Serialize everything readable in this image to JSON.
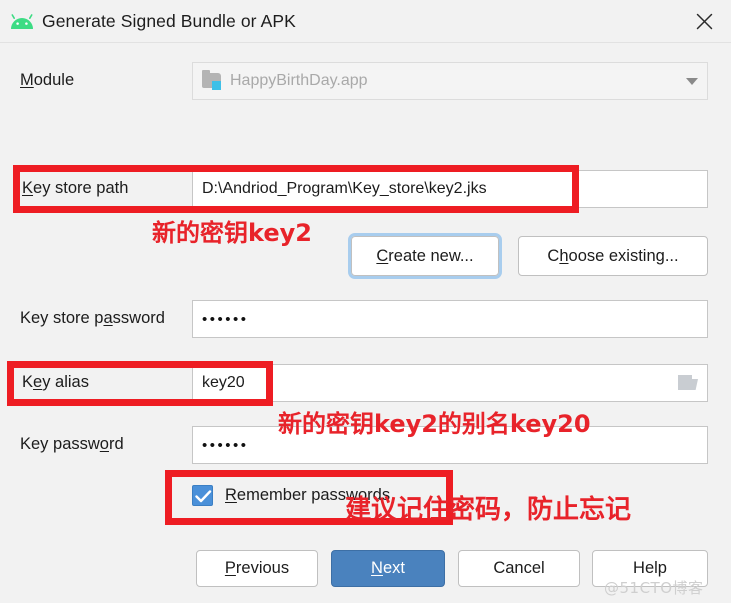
{
  "window": {
    "title": "Generate Signed Bundle or APK",
    "app_icon": "android-icon",
    "close_icon": "close-icon"
  },
  "form": {
    "module": {
      "label": "Module",
      "value": "HappyBirthDay.app",
      "icon": "folder-icon",
      "dropdown_icon": "chevron-down-icon",
      "disabled": true
    },
    "key_store_path": {
      "label_prefix": "K",
      "label_rest": "ey store path",
      "value": "D:\\Andriod_Program\\Key_store\\key2.jks"
    },
    "key_store_password": {
      "label_prefix": "Key store p",
      "label_mnemonic": "a",
      "label_rest": "ssword",
      "value": "••••••"
    },
    "key_alias": {
      "label_prefix": "K",
      "label_mnemonic": "e",
      "label_rest": "y alias",
      "value": "key20",
      "icon": "folder-icon"
    },
    "key_password": {
      "label_prefix": "Key passw",
      "label_mnemonic": "o",
      "label_rest": "rd",
      "value": "••••••"
    },
    "remember_passwords": {
      "label_prefix": "R",
      "label_rest": "emember passwords",
      "checked": true
    }
  },
  "buttons": {
    "create_new": {
      "prefix": "C",
      "mnemonic": "",
      "rest": "reate new..."
    },
    "choose_existing": {
      "prefix": "C",
      "mnemonic": "h",
      "rest": "oose existing..."
    },
    "previous": {
      "prefix": "",
      "mnemonic": "P",
      "rest": "revious"
    },
    "next": {
      "prefix": "",
      "mnemonic": "N",
      "rest": "ext"
    },
    "cancel": {
      "label": "Cancel"
    },
    "help": {
      "label": "Help"
    }
  },
  "annotations": [
    {
      "id": "key2",
      "text": "新的密钥key2"
    },
    {
      "id": "alias",
      "text": "新的密钥key2的别名key20"
    },
    {
      "id": "remember",
      "text": "建议记住密码，防止忘记"
    }
  ],
  "watermark": "@51CTO博客",
  "colors": {
    "android_green": "#3ddc84",
    "annotation_red": "#e8232a",
    "redbox_red": "#ee1d23",
    "primary_button": "#4a82be",
    "checkbox_blue": "#4a90d9",
    "focus_ring": "#a8cdee",
    "dialog_bg": "#f2f2f2"
  }
}
